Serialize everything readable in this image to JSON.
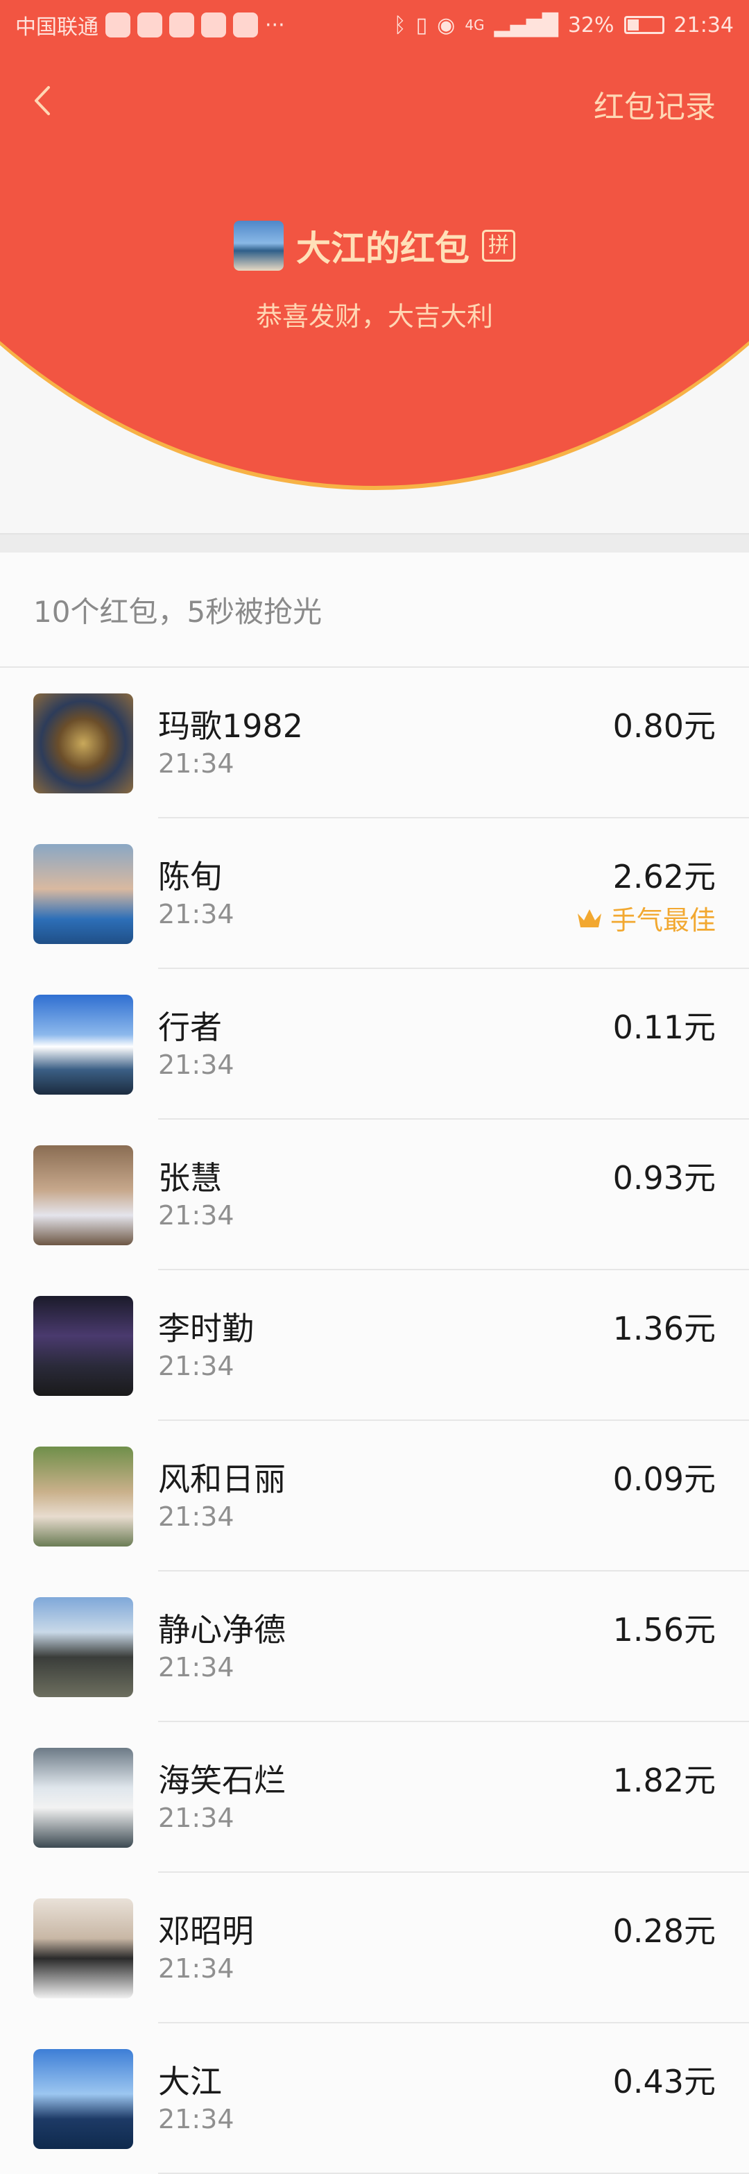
{
  "status_bar": {
    "carrier": "中国联通",
    "more": "···",
    "network": "4G",
    "battery": "32%",
    "battery_level": 0.32,
    "time": "21:34"
  },
  "nav": {
    "back_icon": "chevron-left-icon",
    "record_label": "红包记录"
  },
  "header": {
    "sender_name": "大江的红包",
    "pin_badge": "拼",
    "greeting": "恭喜发财，大吉大利",
    "accent_color": "#f25542",
    "gold_color": "#ffe0b8"
  },
  "summary": "10个红包，5秒被抢光",
  "best_luck_label": "手气最佳",
  "records": [
    {
      "name": "玛歌1982",
      "time": "21:34",
      "amount": "0.80元",
      "best": false
    },
    {
      "name": "陈旬",
      "time": "21:34",
      "amount": "2.62元",
      "best": true
    },
    {
      "name": "行者",
      "time": "21:34",
      "amount": "0.11元",
      "best": false
    },
    {
      "name": "张慧",
      "time": "21:34",
      "amount": "0.93元",
      "best": false
    },
    {
      "name": "李时勤",
      "time": "21:34",
      "amount": "1.36元",
      "best": false
    },
    {
      "name": "风和日丽",
      "time": "21:34",
      "amount": "0.09元",
      "best": false
    },
    {
      "name": "静心净德",
      "time": "21:34",
      "amount": "1.56元",
      "best": false
    },
    {
      "name": "海笑石烂",
      "time": "21:34",
      "amount": "1.82元",
      "best": false
    },
    {
      "name": "邓昭明",
      "time": "21:34",
      "amount": "0.28元",
      "best": false
    },
    {
      "name": "大江",
      "time": "21:34",
      "amount": "0.43元",
      "best": false
    }
  ]
}
